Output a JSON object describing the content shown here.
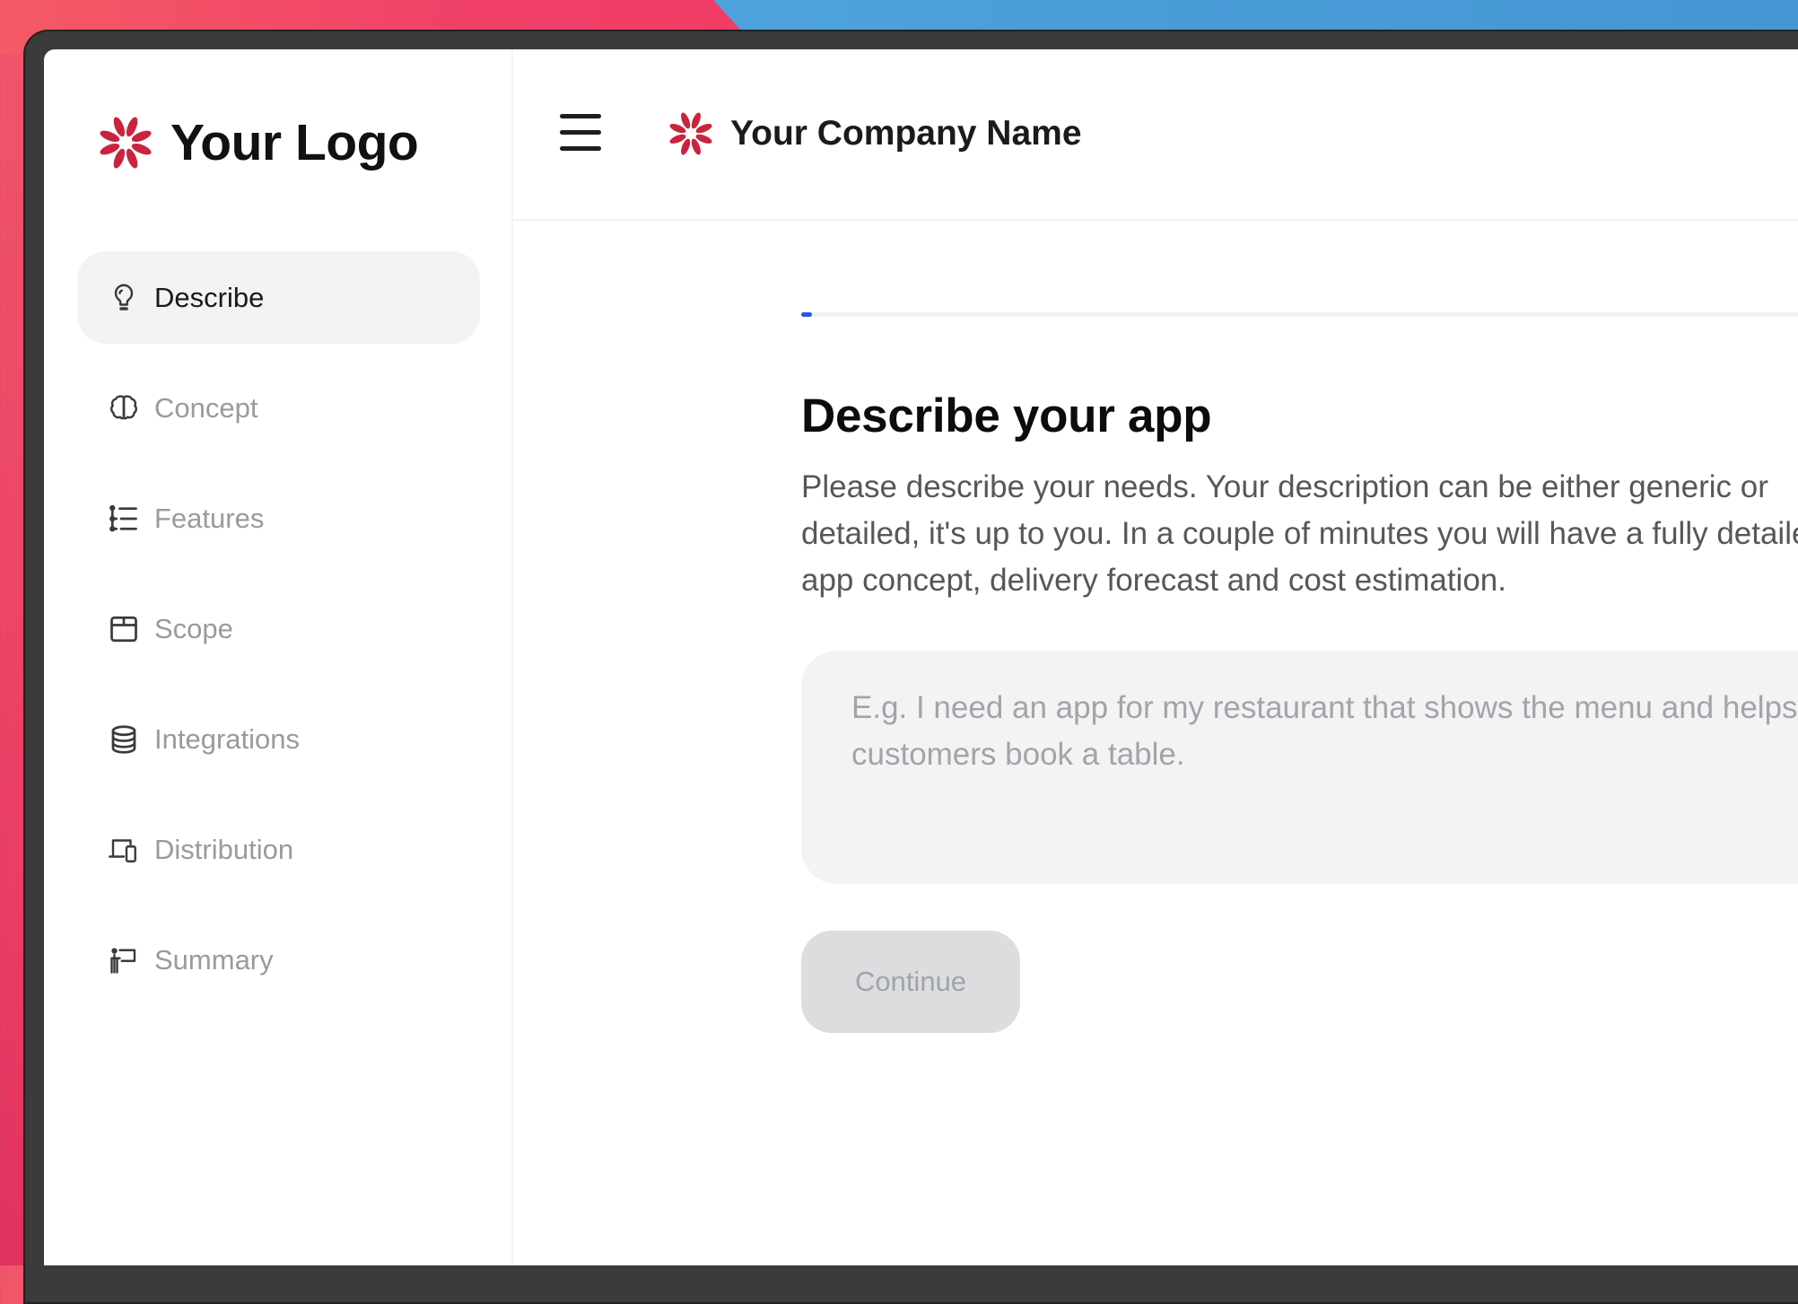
{
  "sidebar": {
    "brand": {
      "logo_text": "Your Logo",
      "icon": "flower-logo-icon"
    },
    "items": [
      {
        "label": "Describe",
        "icon": "lightbulb-icon",
        "active": true
      },
      {
        "label": "Concept",
        "icon": "brain-icon",
        "active": false
      },
      {
        "label": "Features",
        "icon": "list-tree-icon",
        "active": false
      },
      {
        "label": "Scope",
        "icon": "box-icon",
        "active": false
      },
      {
        "label": "Integrations",
        "icon": "database-icon",
        "active": false
      },
      {
        "label": "Distribution",
        "icon": "devices-icon",
        "active": false
      },
      {
        "label": "Summary",
        "icon": "presentation-icon",
        "active": false
      }
    ]
  },
  "header": {
    "menu_icon": "hamburger-icon",
    "company_name": "Your Company Name",
    "company_icon": "flower-logo-icon"
  },
  "main": {
    "progress_percent": 1,
    "title": "Describe your app",
    "description": "Please describe your needs. Your description can be either generic or detailed, it's up to you. In a couple of minutes you will have a fully detailed app concept, delivery forecast and cost estimation.",
    "textarea": {
      "value": "",
      "placeholder": "E.g. I need an app for my restaurant that shows the menu and helps customers book a table."
    },
    "continue_label": "Continue",
    "continue_disabled": true
  },
  "colors": {
    "brand": "#c8243f",
    "progress": "#2456e0",
    "active_nav_bg": "#f3f3f4",
    "button_disabled_bg": "#dcdddf"
  }
}
